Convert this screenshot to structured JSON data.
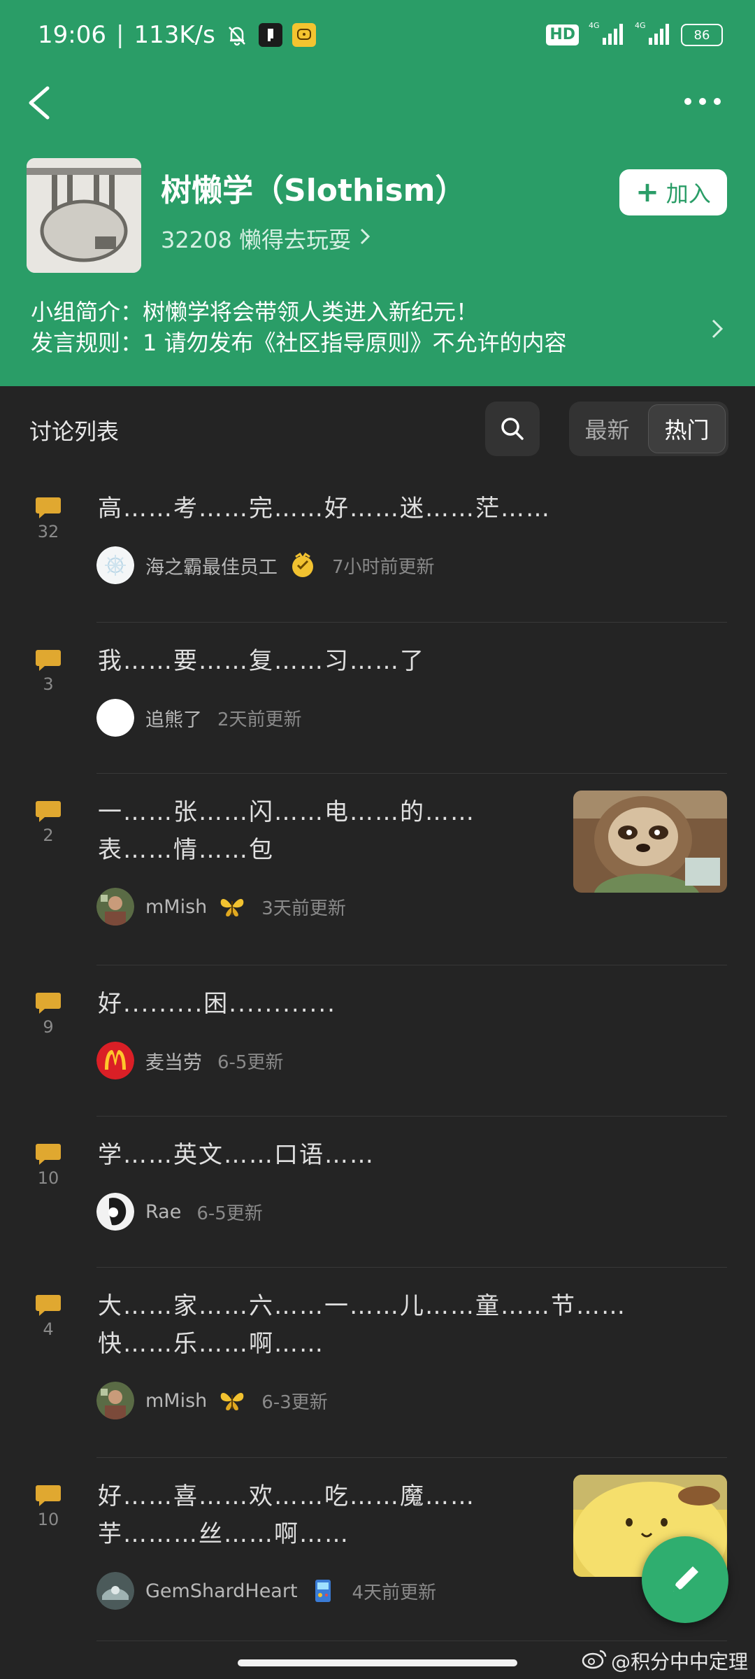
{
  "status": {
    "time": "19:06",
    "speed": "113K/s",
    "hd": "HD",
    "net1": "4G",
    "net2": "4G",
    "battery": "86"
  },
  "group": {
    "name": "树懒学（Slothism）",
    "members": "32208 懒得去玩耍",
    "join_label": "加入",
    "intro": "小组简介：树懒学将会带领人类进入新纪元！",
    "rules": "发言规则：1 请勿发布《社区指导原则》不允许的内容"
  },
  "list": {
    "title": "讨论列表",
    "sort_tabs": [
      "最新",
      "热门"
    ],
    "active_tab": "热门"
  },
  "topics": [
    {
      "count": "32",
      "title_lines": [
        "高……考……完……好……迷……茫……"
      ],
      "author": "海之霸最佳员工",
      "time": "7小时前更新",
      "badge": "medal"
    },
    {
      "count": "3",
      "title_lines": [
        "我……要……复……习……了"
      ],
      "author": "追熊了",
      "time": "2天前更新",
      "badge": ""
    },
    {
      "count": "2",
      "title_lines": [
        "一……张……闪……电……的……",
        "表……情……包"
      ],
      "author": "mMish",
      "time": "3天前更新",
      "badge": "butterfly",
      "thumb": "sloth"
    },
    {
      "count": "9",
      "title_lines": [
        "好.........困............"
      ],
      "author": "麦当劳",
      "time": "6-5更新",
      "badge": ""
    },
    {
      "count": "10",
      "title_lines": [
        "学……英文……口语……"
      ],
      "author": "Rae",
      "time": "6-5更新",
      "badge": ""
    },
    {
      "count": "4",
      "title_lines": [
        "大……家……六……一……儿……童……节……",
        "快……乐……啊……"
      ],
      "author": "mMish",
      "time": "6-3更新",
      "badge": "butterfly"
    },
    {
      "count": "10",
      "title_lines": [
        "好……喜……欢……吃……魔……",
        "芋………丝……啊……"
      ],
      "author": "GemShardHeart",
      "time": "4天前更新",
      "badge": "arcade",
      "thumb": "pudding"
    }
  ],
  "watermark": "@积分中中定理"
}
